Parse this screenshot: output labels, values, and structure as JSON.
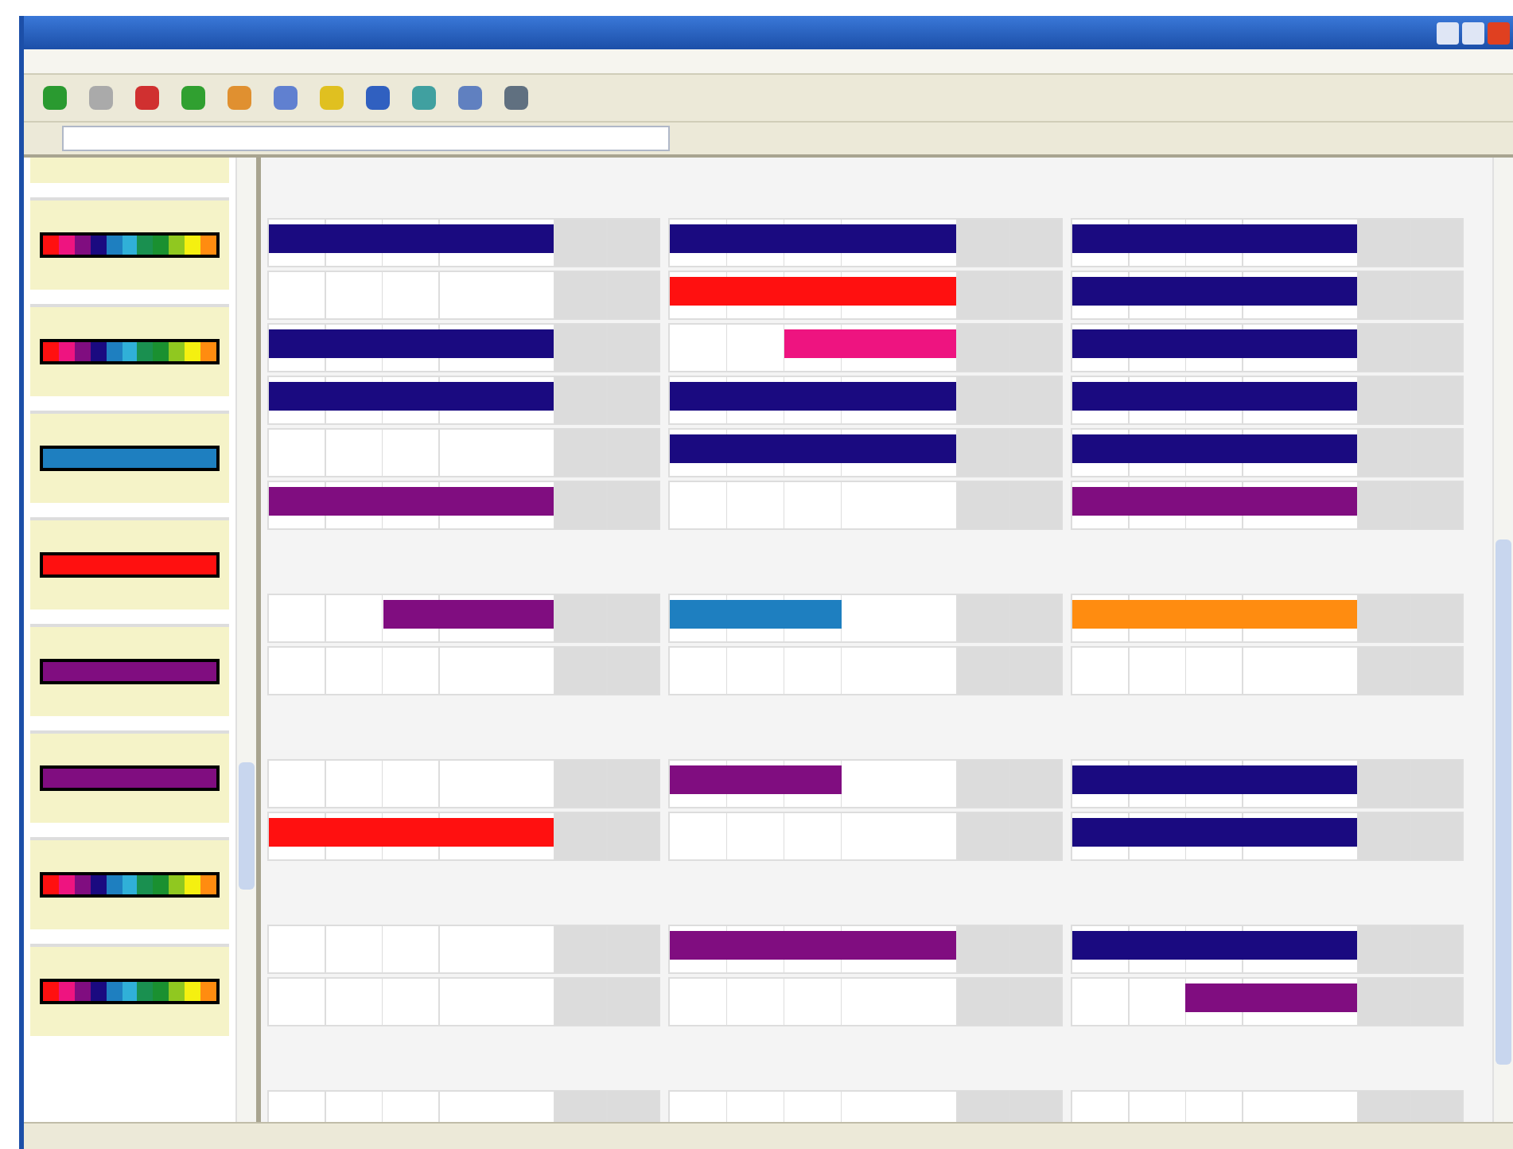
{
  "sidebar": {
    "cards": [
      {
        "kind": "spectrum"
      },
      {
        "kind": "spectrum"
      },
      {
        "kind": "solid",
        "color": "#1e7fc0"
      },
      {
        "kind": "solid",
        "color": "#ff1010"
      },
      {
        "kind": "solid",
        "color": "#800d80"
      },
      {
        "kind": "solid",
        "color": "#800d80"
      },
      {
        "kind": "spectrum"
      },
      {
        "kind": "spectrum"
      }
    ]
  },
  "groups": [
    {
      "panels": [
        {
          "rows": [
            {
              "kind": "bar",
              "color": "#1a0a80",
              "level": 1
            },
            {
              "kind": "empty"
            },
            {
              "kind": "bar",
              "color": "#1a0a80",
              "level": 1
            },
            {
              "kind": "bar",
              "color": "#1a0a80",
              "level": 1
            },
            {
              "kind": "empty"
            },
            {
              "kind": "bar",
              "color": "#800d80",
              "level": 1
            }
          ]
        },
        {
          "rows": [
            {
              "kind": "bar",
              "color": "#1a0a80",
              "level": 1
            },
            {
              "kind": "bar",
              "color": "#ff1010",
              "level": 1
            },
            {
              "kind": "late-bar",
              "color": "#ee1480",
              "level": 0.6
            },
            {
              "kind": "bar",
              "color": "#1a0a80",
              "level": 1
            },
            {
              "kind": "bar",
              "color": "#1a0a80",
              "level": 1
            },
            {
              "kind": "empty"
            }
          ]
        },
        {
          "rows": [
            {
              "kind": "bar",
              "color": "#1a0a80",
              "level": 1
            },
            {
              "kind": "bar",
              "color": "#1a0a80",
              "level": 1
            },
            {
              "kind": "bar",
              "color": "#1a0a80",
              "level": 1
            },
            {
              "kind": "bar",
              "color": "#1a0a80",
              "level": 1
            },
            {
              "kind": "bar",
              "color": "#1a0a80",
              "level": 1
            },
            {
              "kind": "bar",
              "color": "#800d80",
              "level": 1
            }
          ]
        }
      ]
    },
    {
      "panels": [
        {
          "rows": [
            {
              "kind": "late-bar",
              "color": "#800d80",
              "level": 0.6
            },
            {
              "kind": "empty"
            }
          ]
        },
        {
          "rows": [
            {
              "kind": "bar",
              "color": "#1e7fc0",
              "level": 0.6
            },
            {
              "kind": "empty"
            }
          ]
        },
        {
          "rows": [
            {
              "kind": "bar",
              "color": "#ff8c10",
              "level": 1
            },
            {
              "kind": "empty"
            }
          ]
        }
      ]
    },
    {
      "panels": [
        {
          "rows": [
            {
              "kind": "empty"
            },
            {
              "kind": "bar",
              "color": "#ff1010",
              "level": 1
            }
          ]
        },
        {
          "rows": [
            {
              "kind": "bar",
              "color": "#800d80",
              "level": 0.6
            },
            {
              "kind": "empty"
            }
          ]
        },
        {
          "rows": [
            {
              "kind": "bar",
              "color": "#1a0a80",
              "level": 1
            },
            {
              "kind": "bar",
              "color": "#1a0a80",
              "level": 1
            }
          ]
        }
      ]
    },
    {
      "panels": [
        {
          "rows": [
            {
              "kind": "empty"
            },
            {
              "kind": "empty"
            }
          ]
        },
        {
          "rows": [
            {
              "kind": "bar",
              "color": "#800d80",
              "level": 1
            },
            {
              "kind": "empty"
            }
          ]
        },
        {
          "rows": [
            {
              "kind": "bar",
              "color": "#1a0a80",
              "level": 1
            },
            {
              "kind": "late-bar",
              "color": "#800d80",
              "level": 0.6
            }
          ]
        }
      ]
    },
    {
      "panels": [
        {
          "rows": [
            {
              "kind": "empty"
            }
          ]
        },
        {
          "rows": [
            {
              "kind": "empty"
            }
          ]
        },
        {
          "rows": [
            {
              "kind": "empty"
            }
          ]
        }
      ]
    }
  ]
}
